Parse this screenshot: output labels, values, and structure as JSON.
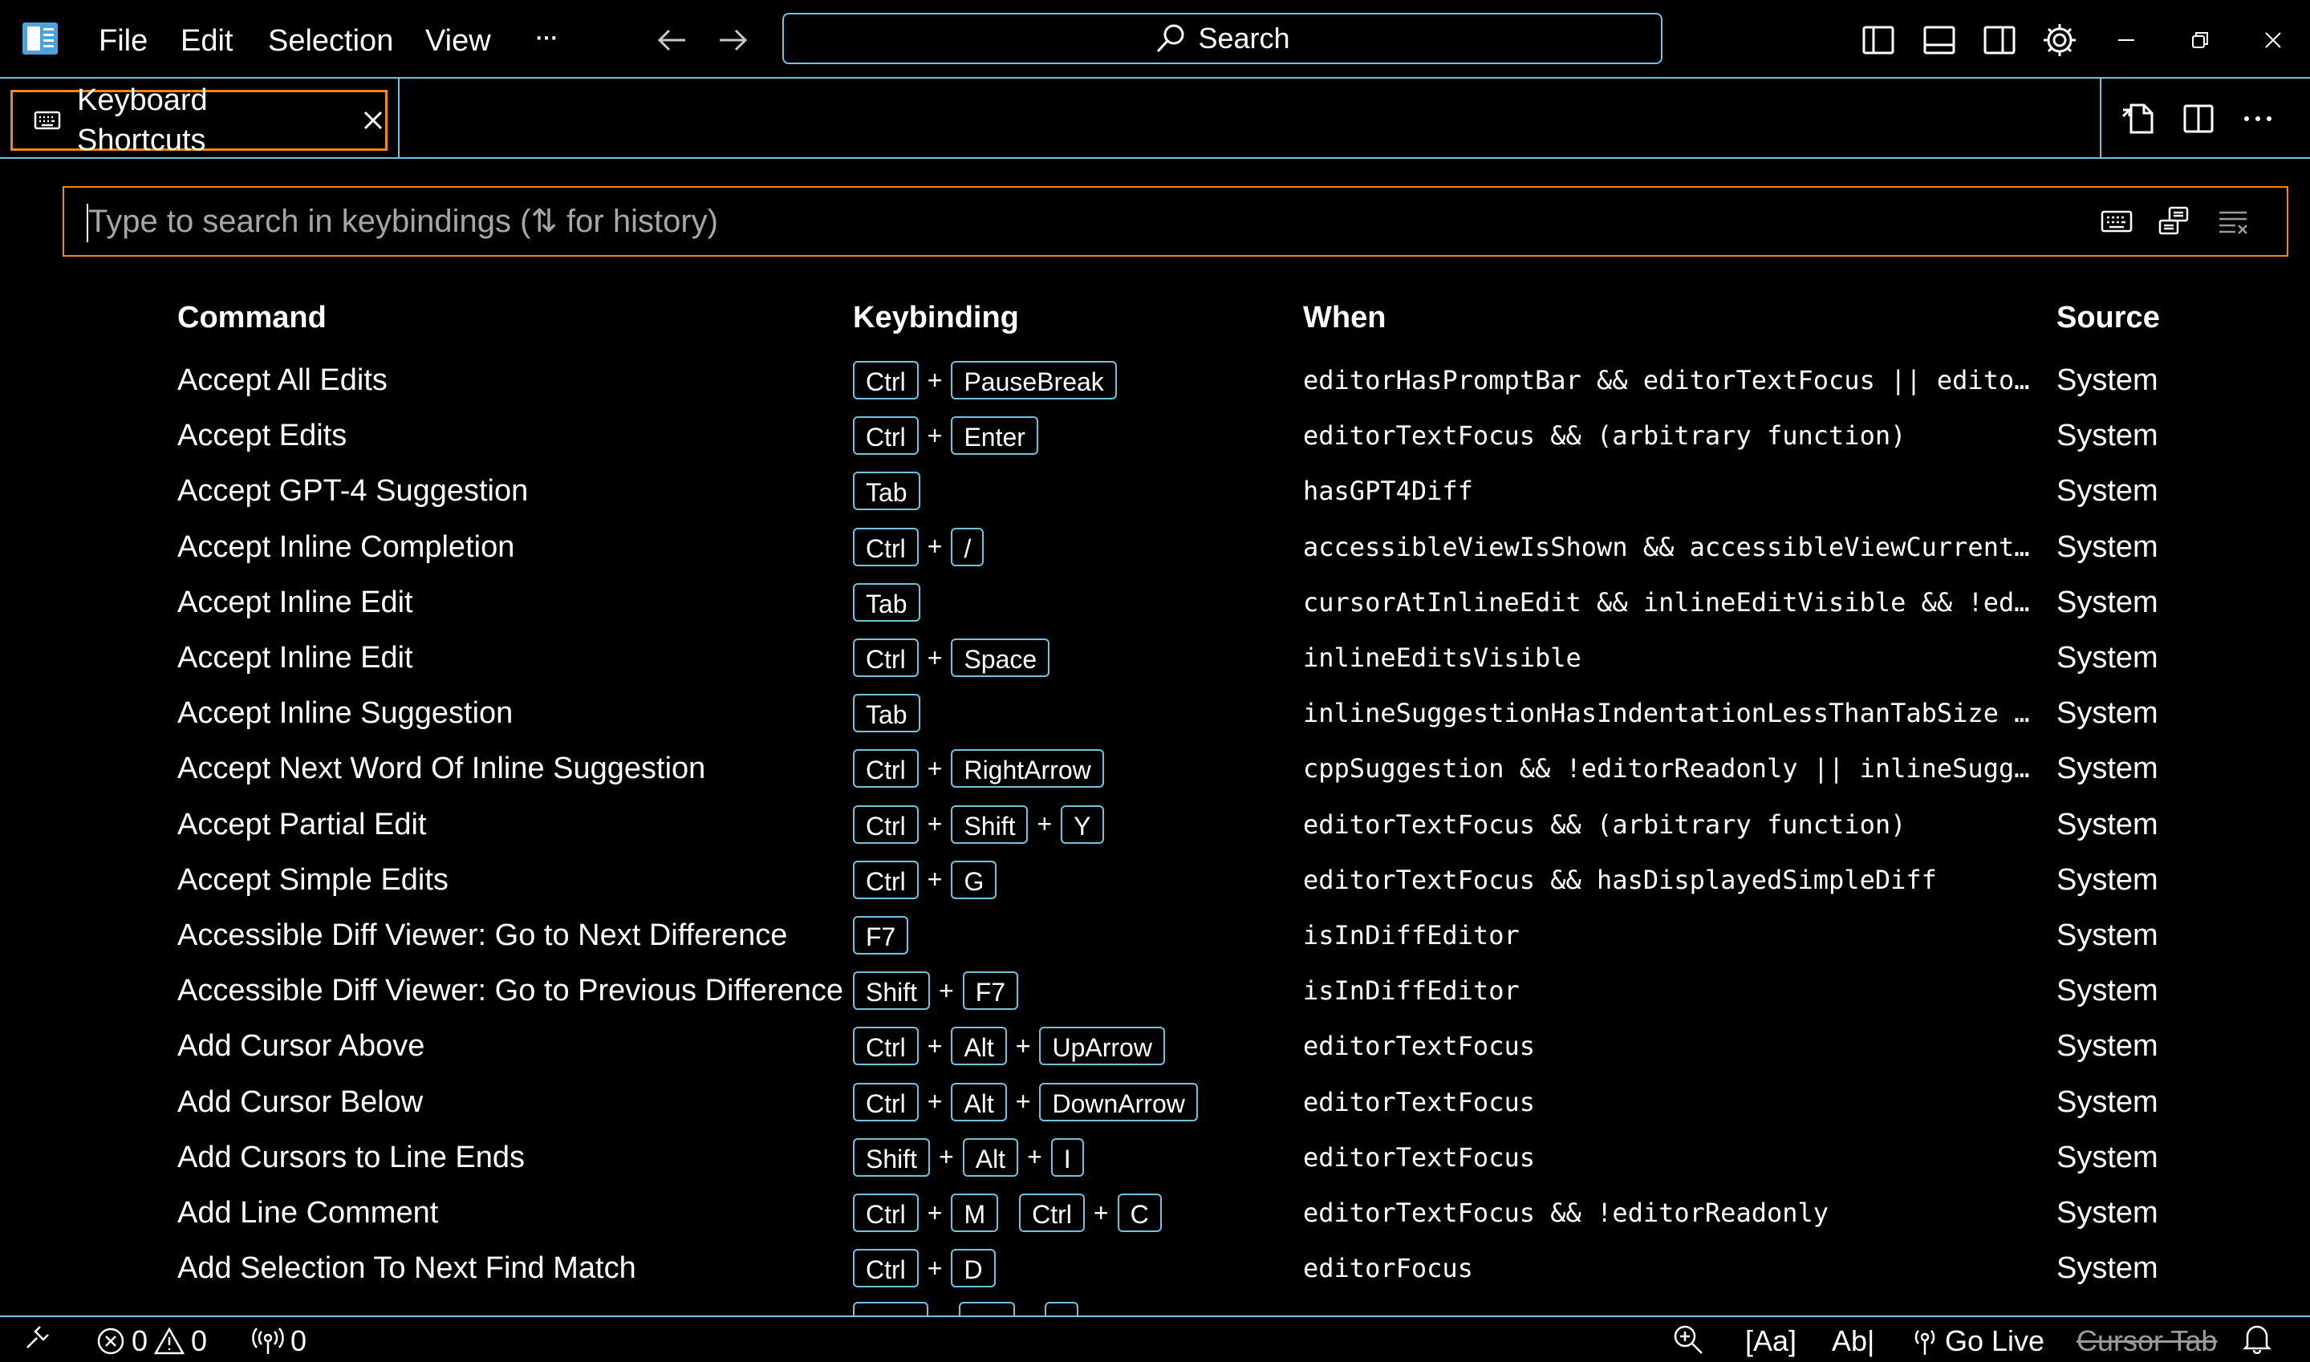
{
  "colors": {
    "border": "#6fc3df",
    "focus": "#f38518",
    "background": "#000000",
    "placeholder": "#a6a6a6"
  },
  "titlebar": {
    "menu": [
      "File",
      "Edit",
      "Selection",
      "View"
    ],
    "more": "···",
    "search": "Search"
  },
  "tab": {
    "title": "Keyboard Shortcuts"
  },
  "search": {
    "placeholder": "Type to search in keybindings (⇅ for history)"
  },
  "table": {
    "headers": {
      "command": "Command",
      "keybinding": "Keybinding",
      "when": "When",
      "source": "Source"
    },
    "rows": [
      {
        "command": "Accept All Edits",
        "keys": [
          [
            "Ctrl",
            "PauseBreak"
          ]
        ],
        "when": "editorHasPromptBar && editorTextFocus || editorT…",
        "source": "System"
      },
      {
        "command": "Accept Edits",
        "keys": [
          [
            "Ctrl",
            "Enter"
          ]
        ],
        "when": "editorTextFocus && (arbitrary function)",
        "source": "System"
      },
      {
        "command": "Accept GPT-4 Suggestion",
        "keys": [
          [
            "Tab"
          ]
        ],
        "when": "hasGPT4Diff",
        "source": "System"
      },
      {
        "command": "Accept Inline Completion",
        "keys": [
          [
            "Ctrl",
            "/"
          ]
        ],
        "when": "accessibleViewIsShown && accessibleViewCurrentPr…",
        "source": "System"
      },
      {
        "command": "Accept Inline Edit",
        "keys": [
          [
            "Tab"
          ]
        ],
        "when": "cursorAtInlineEdit && inlineEditVisible && !edit…",
        "source": "System"
      },
      {
        "command": "Accept Inline Edit",
        "keys": [
          [
            "Ctrl",
            "Space"
          ]
        ],
        "when": "inlineEditsVisible",
        "source": "System"
      },
      {
        "command": "Accept Inline Suggestion",
        "keys": [
          [
            "Tab"
          ]
        ],
        "when": "inlineSuggestionHasIndentationLessThanTabSize &&…",
        "source": "System"
      },
      {
        "command": "Accept Next Word Of Inline Suggestion",
        "keys": [
          [
            "Ctrl",
            "RightArrow"
          ]
        ],
        "when": "cppSuggestion && !editorReadonly || inlineSugges…",
        "source": "System"
      },
      {
        "command": "Accept Partial Edit",
        "keys": [
          [
            "Ctrl",
            "Shift",
            "Y"
          ]
        ],
        "when": "editorTextFocus && (arbitrary function)",
        "source": "System"
      },
      {
        "command": "Accept Simple Edits",
        "keys": [
          [
            "Ctrl",
            "G"
          ]
        ],
        "when": "editorTextFocus && hasDisplayedSimpleDiff",
        "source": "System"
      },
      {
        "command": "Accessible Diff Viewer: Go to Next Difference",
        "keys": [
          [
            "F7"
          ]
        ],
        "when": "isInDiffEditor",
        "source": "System"
      },
      {
        "command": "Accessible Diff Viewer: Go to Previous Difference",
        "keys": [
          [
            "Shift",
            "F7"
          ]
        ],
        "when": "isInDiffEditor",
        "source": "System"
      },
      {
        "command": "Add Cursor Above",
        "keys": [
          [
            "Ctrl",
            "Alt",
            "UpArrow"
          ]
        ],
        "when": "editorTextFocus",
        "source": "System"
      },
      {
        "command": "Add Cursor Below",
        "keys": [
          [
            "Ctrl",
            "Alt",
            "DownArrow"
          ]
        ],
        "when": "editorTextFocus",
        "source": "System"
      },
      {
        "command": "Add Cursors to Line Ends",
        "keys": [
          [
            "Shift",
            "Alt",
            "I"
          ]
        ],
        "when": "editorTextFocus",
        "source": "System"
      },
      {
        "command": "Add Line Comment",
        "keys": [
          [
            "Ctrl",
            "M"
          ],
          [
            "Ctrl",
            "C"
          ]
        ],
        "when": "editorTextFocus && !editorReadonly",
        "source": "System"
      },
      {
        "command": "Add Selection To Next Find Match",
        "keys": [
          [
            "Ctrl",
            "D"
          ]
        ],
        "when": "editorFocus",
        "source": "System"
      }
    ]
  },
  "statusbar": {
    "errors": "0",
    "warnings": "0",
    "ports": "0",
    "case_toggle": "[Aa]",
    "word_toggle": "Ab|",
    "go_live": "Go Live",
    "cursor_tab": "Cursor Tab"
  }
}
